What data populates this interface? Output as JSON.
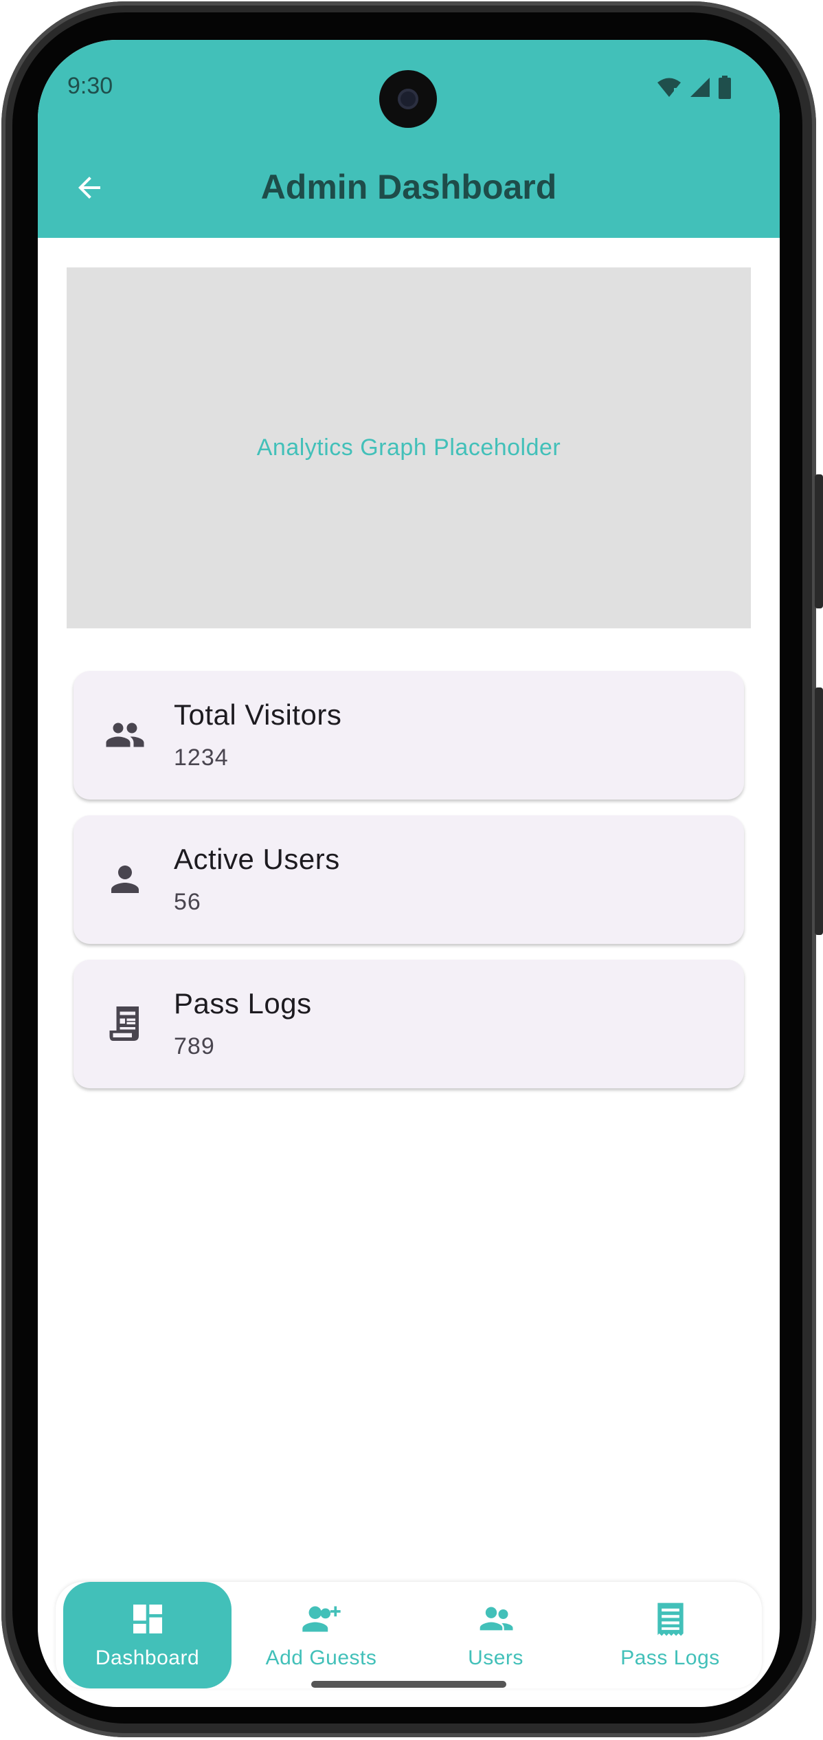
{
  "status_bar": {
    "time": "9:30",
    "icons": [
      "wifi-icon",
      "signal-icon",
      "battery-icon"
    ]
  },
  "header": {
    "title": "Admin Dashboard",
    "back_icon": "arrow-back-icon"
  },
  "graph": {
    "placeholder_text": "Analytics Graph Placeholder"
  },
  "stats": [
    {
      "icon": "people-icon",
      "title": "Total Visitors",
      "value": "1234"
    },
    {
      "icon": "person-icon",
      "title": "Active Users",
      "value": "56"
    },
    {
      "icon": "receipt-icon",
      "title": "Pass Logs",
      "value": "789"
    }
  ],
  "bottom_nav": {
    "items": [
      {
        "icon": "dashboard-icon",
        "label": "Dashboard",
        "active": true
      },
      {
        "icon": "person-add-icon",
        "label": "Add Guests",
        "active": false
      },
      {
        "icon": "users-icon",
        "label": "Users",
        "active": false
      },
      {
        "icon": "list-icon",
        "label": "Pass Logs",
        "active": false
      }
    ]
  },
  "colors": {
    "primary": "#42c0b9",
    "header_title": "#1e4c49",
    "card_bg": "#f4f0f7",
    "placeholder_bg": "#e0e0e0",
    "icon_dark": "#49454f"
  }
}
